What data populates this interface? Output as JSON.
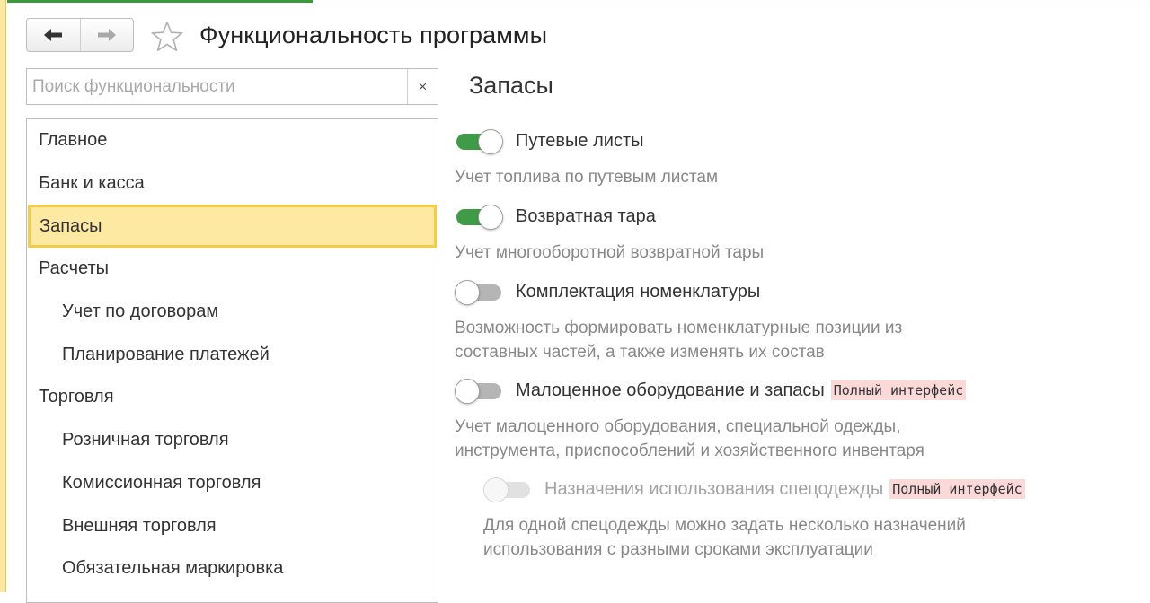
{
  "page_title": "Функциональность программы",
  "search": {
    "placeholder": "Поиск функциональности",
    "clear_label": "×"
  },
  "nav": {
    "items": [
      {
        "label": "Главное"
      },
      {
        "label": "Банк и касса"
      },
      {
        "label": "Запасы"
      },
      {
        "label": "Расчеты"
      },
      {
        "label": "Учет по договорам"
      },
      {
        "label": "Планирование платежей"
      },
      {
        "label": "Торговля"
      },
      {
        "label": "Розничная торговля"
      },
      {
        "label": "Комиссионная торговля"
      },
      {
        "label": "Внешняя торговля"
      },
      {
        "label": "Обязательная маркировка"
      }
    ],
    "active_label": "Запасы"
  },
  "section": {
    "title": "Запасы",
    "options": [
      {
        "label": "Путевые листы",
        "state": "on",
        "description": "Учет топлива по путевым листам"
      },
      {
        "label": "Возвратная тара",
        "state": "on",
        "description": "Учет многооборотной возвратной тары"
      },
      {
        "label": "Комплектация номенклатуры",
        "state": "off",
        "description_lines": [
          "Возможность формировать номенклатурные позиции из",
          "составных частей, а также изменять их состав"
        ]
      },
      {
        "label": "Малоценное оборудование и запасы",
        "state": "off",
        "badge": "Полный интерфейс",
        "description_lines": [
          "Учет малоценного оборудования, специальной одежды,",
          "инструмента, приспособлений и хозяйственного инвентаря"
        ]
      },
      {
        "label": "Назначения использования спецодежды",
        "state": "disabled",
        "badge": "Полный интерфейс",
        "description_lines": [
          "Для одной спецодежды можно задать несколько назначений",
          "использования с разными сроками эксплуатации"
        ]
      }
    ]
  },
  "colors": {
    "accent_green": "#3f9b47",
    "active_nav_bg": "#fde9a2",
    "active_nav_border": "#f2cd4c",
    "badge_bg": "#fcd9d9"
  }
}
